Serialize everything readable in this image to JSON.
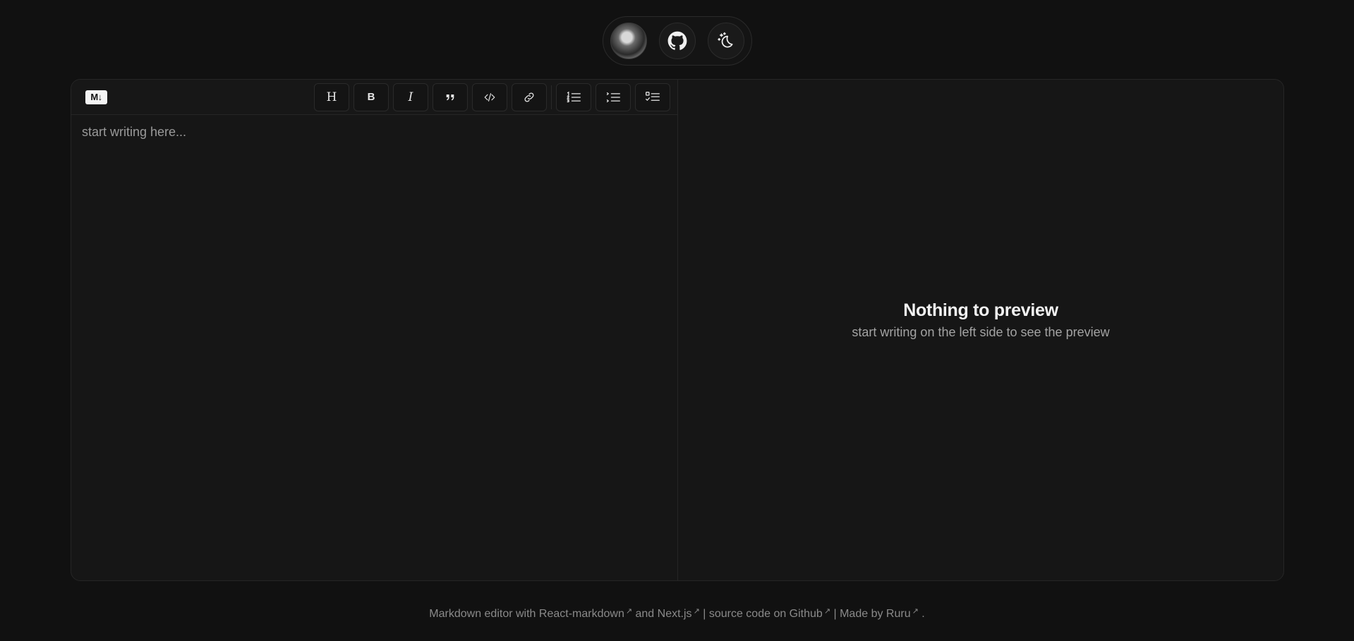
{
  "header": {
    "avatar_alt": "Ruru avatar",
    "github_icon": "github-icon",
    "theme_icon": "moon-stars-icon"
  },
  "toolbar": {
    "logo_text": "M↓",
    "heading_label": "H",
    "bold_label": "B",
    "italic_label": "I"
  },
  "editor": {
    "placeholder": "start writing here..."
  },
  "preview": {
    "title": "Nothing to preview",
    "subtitle": "start writing on the left side to see the preview"
  },
  "footer": {
    "text_1": "Markdown editor with ",
    "link_react": "React-markdown",
    "text_2": " and ",
    "link_next": "Next.js",
    "text_3": " | ",
    "link_source": "source code on Github",
    "text_4": " | ",
    "link_made": "Made by Ruru",
    "text_5": " .",
    "ext_mark": "↗"
  },
  "colors": {
    "background": "#111111",
    "panel": "#161616",
    "border": "#262626",
    "text": "#e6e6e6",
    "muted": "#9a9a9a"
  }
}
